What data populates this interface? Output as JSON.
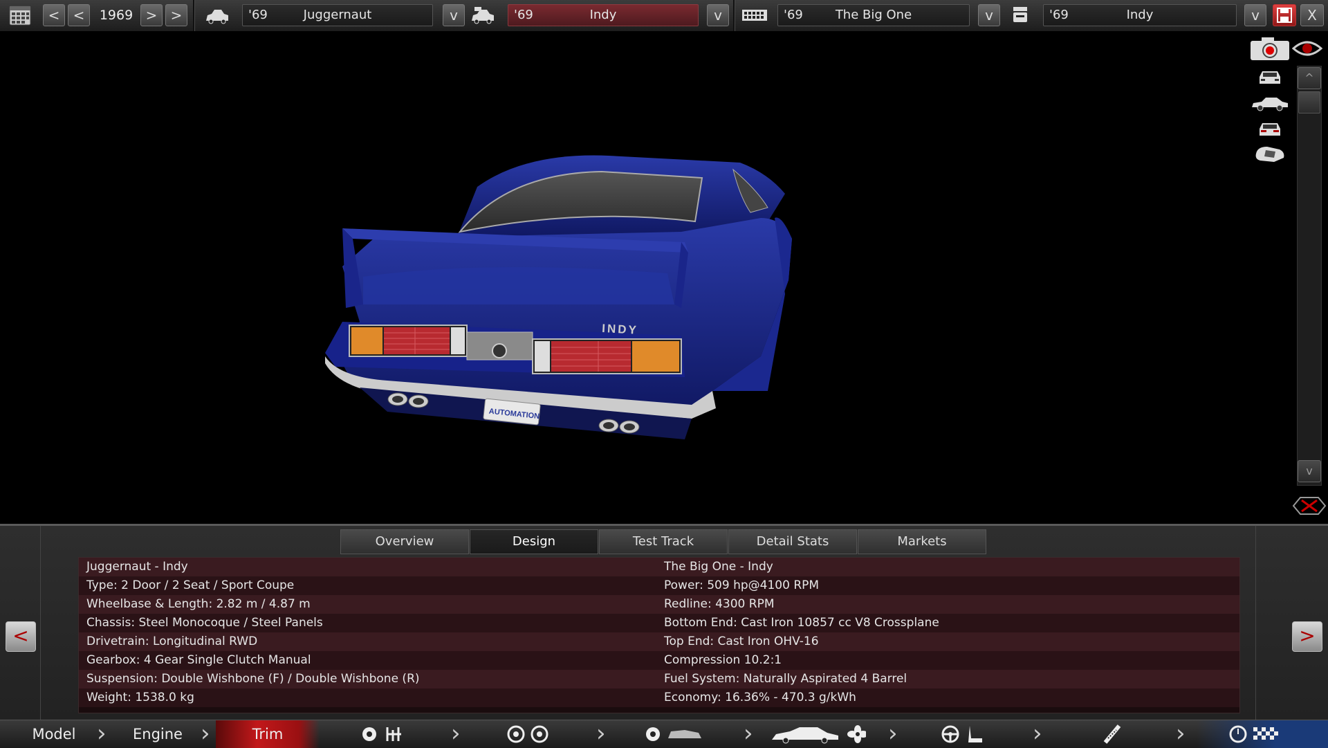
{
  "topbar": {
    "year": "1969",
    "prev_arrow": "<",
    "next_arrow": ">",
    "dropdown_arrow": "v",
    "close_glyph": "X",
    "model_selector": {
      "year": "'69",
      "name": "Juggernaut"
    },
    "trim_selector": {
      "year": "'69",
      "name": "Indy"
    },
    "engine_selector": {
      "year": "'69",
      "name": "The Big One"
    },
    "engine_variant_selector": {
      "year": "'69",
      "name": "Indy"
    }
  },
  "viewport": {
    "car_badge": "INDY",
    "plate": "AUTOMATION",
    "scroll_up": "^",
    "scroll_down": "v"
  },
  "tabs": [
    {
      "label": "Overview",
      "active": false
    },
    {
      "label": "Design",
      "active": true
    },
    {
      "label": "Test Track",
      "active": false
    },
    {
      "label": "Detail Stats",
      "active": false
    },
    {
      "label": "Markets",
      "active": false
    }
  ],
  "info": {
    "left": [
      "Juggernaut - Indy",
      "Type: 2 Door / 2 Seat / Sport Coupe",
      "Wheelbase & Length: 2.82 m / 4.87 m",
      "Chassis: Steel Monocoque / Steel Panels",
      "Drivetrain: Longitudinal RWD",
      "Gearbox: 4 Gear Single Clutch Manual",
      "Suspension: Double Wishbone (F) / Double Wishbone (R)",
      "Weight: 1538.0 kg"
    ],
    "right": [
      "The Big One - Indy",
      "Power: 509 hp@4100 RPM",
      "Redline: 4300 RPM",
      "Bottom End: Cast Iron 10857 cc V8 Crossplane",
      "Top End: Cast Iron OHV-16",
      "Compression 10.2:1",
      "Fuel System: Naturally Aspirated 4 Barrel",
      "Economy: 16.36% - 470.3 g/kWh"
    ],
    "prev_label": "<",
    "next_label": ">"
  },
  "nav": {
    "model": "Model",
    "engine": "Engine",
    "trim": "Trim",
    "active": "Trim"
  },
  "colors": {
    "accent_red": "#c2181a",
    "car_blue": "#1c2a8c",
    "row_odd": "#3a1b20",
    "row_even": "#2a1216"
  }
}
